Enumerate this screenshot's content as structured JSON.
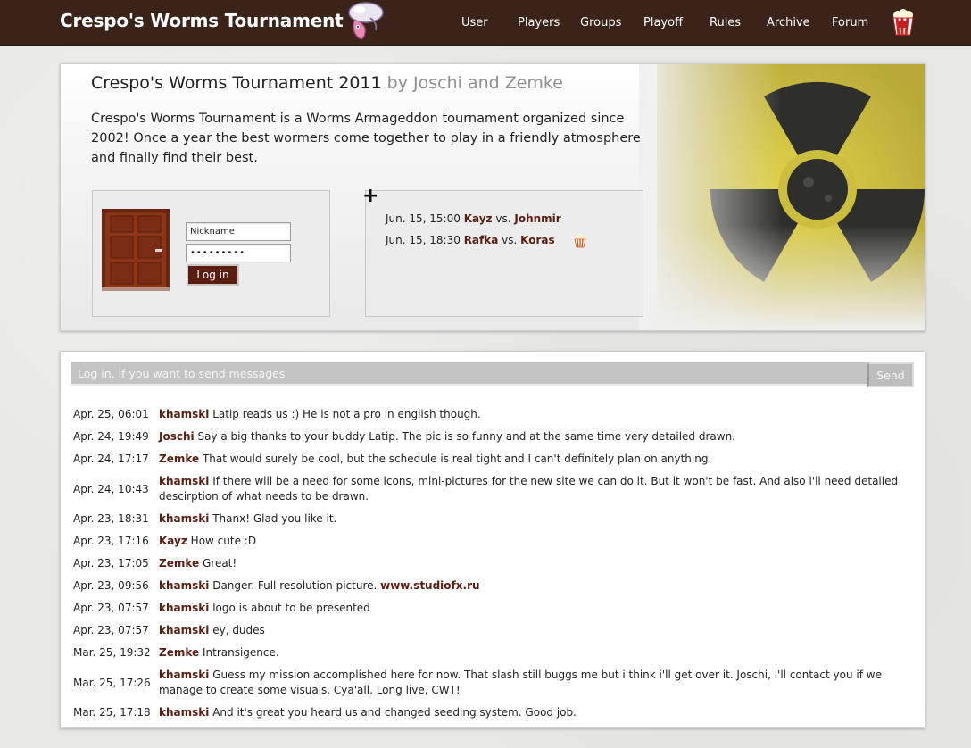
{
  "header": {
    "title": "Crespo's Worms Tournament",
    "nav": [
      "User",
      "Players",
      "Groups",
      "Playoff",
      "Rules",
      "Archive",
      "Forum"
    ]
  },
  "hero": {
    "title": "Crespo's Worms Tournament 2011",
    "byline": "by Joschi and Zemke",
    "description": "Crespo's Worms Tournament is a Worms Armageddon tournament organized since 2002! Once a year the best wormers come together to play in a friendly atmosphere and finally find their best."
  },
  "login": {
    "nickname_value": "Nickname",
    "password_value": "•••••••••",
    "button_label": "Log in"
  },
  "matches": [
    {
      "time": "Jun. 15, 15:00",
      "home": "Kayz",
      "vs": "vs.",
      "away": "Johnmir"
    },
    {
      "time": "Jun. 15, 18:30",
      "home": "Rafka",
      "vs": "vs.",
      "away": "Koras"
    }
  ],
  "chat": {
    "placeholder": "Log in, if you want to send messages",
    "send_label": "Send",
    "messages": [
      {
        "time": "Apr. 25, 06:01",
        "author": "khamski",
        "text": "Latip reads us :) He is not a pro in english though."
      },
      {
        "time": "Apr. 24, 19:49",
        "author": "Joschi",
        "text": "Say a big thanks to your buddy Latip. The pic is so funny and at the same time very detailed drawn."
      },
      {
        "time": "Apr. 24, 17:17",
        "author": "Zemke",
        "text": "That would surely be cool, but the schedule is real tight and I can't definitely plan on anything."
      },
      {
        "time": "Apr. 24, 10:43",
        "author": "khamski",
        "text": "If there will be a need for some icons, mini-pictures for the new site we can do it. But it won't be fast. And also i'll need detailed descirption of what needs to be drawn."
      },
      {
        "time": "Apr. 23, 18:31",
        "author": "khamski",
        "text": "Thanx! Glad you like it."
      },
      {
        "time": "Apr. 23, 17:16",
        "author": "Kayz",
        "text": "How cute :D"
      },
      {
        "time": "Apr. 23, 17:05",
        "author": "Zemke",
        "text": "Great!"
      },
      {
        "time": "Apr. 23, 09:56",
        "author": "khamski",
        "text": "Danger. Full resolution picture. ",
        "link": "www.studiofx.ru"
      },
      {
        "time": "Apr. 23, 07:57",
        "author": "khamski",
        "text": "logo is about to be presented"
      },
      {
        "time": "Apr. 23, 07:57",
        "author": "khamski",
        "text": "ey, dudes"
      },
      {
        "time": "Mar. 25, 19:32",
        "author": "Zemke",
        "text": "Intransigence."
      },
      {
        "time": "Mar. 25, 17:26",
        "author": "khamski",
        "text": "Guess my mission accomplished here for now. That slash still buggs me but i think i'll get over it. Joschi, i'll contact you if we manage to create some visuals. Cya'all. Long live, CWT!"
      },
      {
        "time": "Mar. 25, 17:18",
        "author": "khamski",
        "text": "And it's great you heard us and changed seeding system. Good job."
      }
    ]
  },
  "colors": {
    "topbar": "#3a2319",
    "accent": "#5a1d12",
    "input_bg": "#c4c4c4"
  }
}
